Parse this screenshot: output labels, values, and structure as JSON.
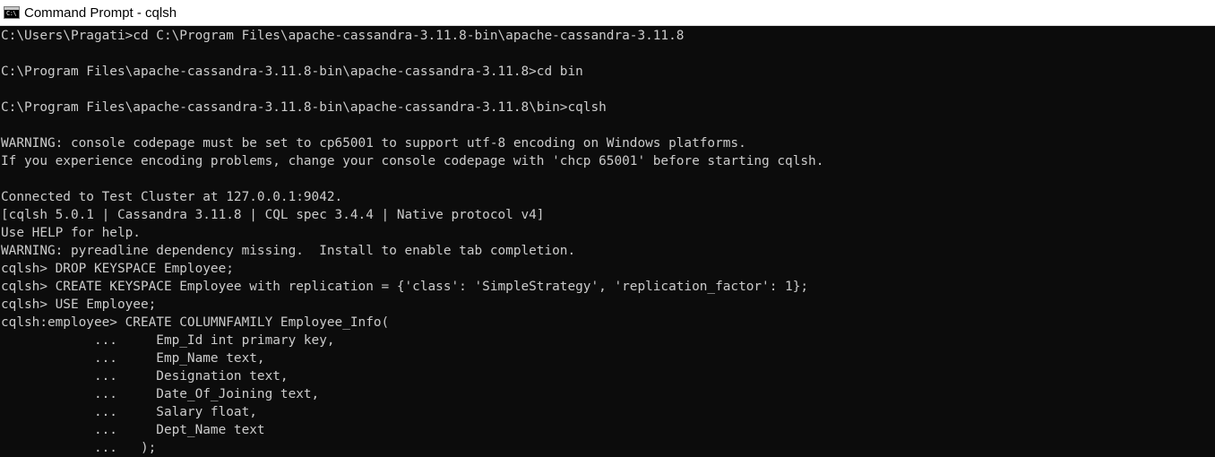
{
  "window": {
    "title": "Command Prompt - cqlsh",
    "icon_name": "cmd-icon",
    "icon_glyph": "C:\\"
  },
  "colors": {
    "console_bg": "#0c0c0c",
    "console_text": "#cccccc",
    "titlebar_bg": "#ffffff"
  },
  "console": {
    "lines": [
      "C:\\Users\\Pragati>cd C:\\Program Files\\apache-cassandra-3.11.8-bin\\apache-cassandra-3.11.8",
      "",
      "C:\\Program Files\\apache-cassandra-3.11.8-bin\\apache-cassandra-3.11.8>cd bin",
      "",
      "C:\\Program Files\\apache-cassandra-3.11.8-bin\\apache-cassandra-3.11.8\\bin>cqlsh",
      "",
      "WARNING: console codepage must be set to cp65001 to support utf-8 encoding on Windows platforms.",
      "If you experience encoding problems, change your console codepage with 'chcp 65001' before starting cqlsh.",
      "",
      "Connected to Test Cluster at 127.0.0.1:9042.",
      "[cqlsh 5.0.1 | Cassandra 3.11.8 | CQL spec 3.4.4 | Native protocol v4]",
      "Use HELP for help.",
      "WARNING: pyreadline dependency missing.  Install to enable tab completion.",
      "cqlsh> DROP KEYSPACE Employee;",
      "cqlsh> CREATE KEYSPACE Employee with replication = {'class': 'SimpleStrategy', 'replication_factor': 1};",
      "cqlsh> USE Employee;",
      "cqlsh:employee> CREATE COLUMNFAMILY Employee_Info(",
      "            ...     Emp_Id int primary key,",
      "            ...     Emp_Name text,",
      "            ...     Designation text,",
      "            ...     Date_Of_Joining text,",
      "            ...     Salary float,",
      "            ...     Dept_Name text",
      "            ...   );"
    ]
  }
}
